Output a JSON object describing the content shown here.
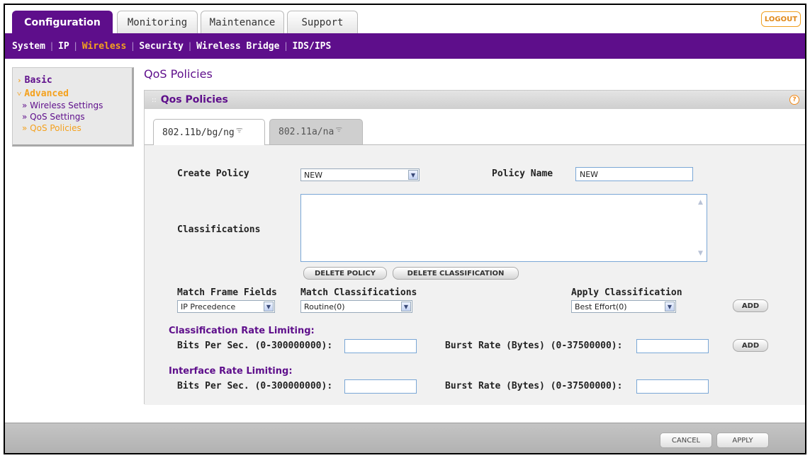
{
  "top_tabs": [
    "Configuration",
    "Monitoring",
    "Maintenance",
    "Support"
  ],
  "logout_label": "LOGOUT",
  "subnav": [
    "System",
    "IP",
    "Wireless",
    "Security",
    "Wireless Bridge",
    "IDS/IPS"
  ],
  "subnav_active": "Wireless",
  "left_menu": {
    "basic": "Basic",
    "advanced": "Advanced",
    "items": [
      "» Wireless Settings",
      "» QoS Settings",
      "» QoS Policies"
    ],
    "active_item": "» QoS Policies"
  },
  "page_title": "QoS Policies",
  "panel": {
    "title": "Qos Policies",
    "help": "?",
    "radio_tabs": [
      "802.11b/bg/ng",
      "802.11a/na"
    ]
  },
  "form": {
    "create_policy_label": "Create Policy",
    "create_policy_value": "NEW",
    "policy_name_label": "Policy Name",
    "policy_name_value": "NEW",
    "classifications_label": "Classifications",
    "delete_policy_btn": "DELETE POLICY",
    "delete_classification_btn": "DELETE CLASSIFICATION",
    "match_frame_fields_label": "Match Frame Fields",
    "match_frame_fields_value": "IP Precedence",
    "match_classifications_label": "Match Classifications",
    "match_classifications_value": "Routine(0)",
    "apply_classification_label": "Apply Classification",
    "apply_classification_value": "Best Effort(0)",
    "add_btn": "ADD",
    "class_rate_heading": "Classification Rate Limiting:",
    "iface_rate_heading": "Interface Rate Limiting:",
    "bits_label": "Bits Per Sec. (0-300000000):",
    "burst_label": "Burst Rate (Bytes) (0-37500000):"
  },
  "footer": {
    "cancel": "CANCEL",
    "apply": "APPLY"
  },
  "colors": {
    "brand_purple": "#5e0e8b",
    "accent_orange": "#f4a11d"
  }
}
